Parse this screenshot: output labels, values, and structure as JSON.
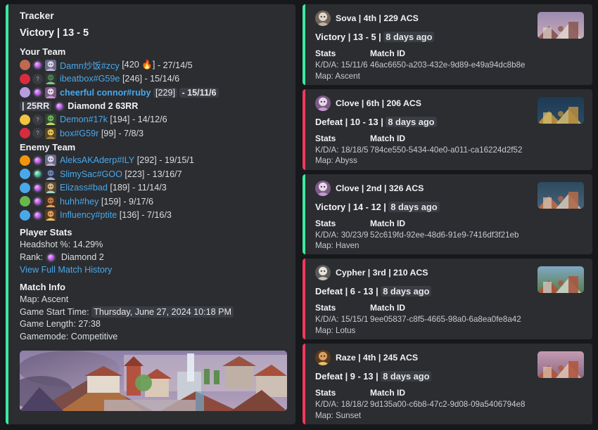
{
  "theme": {
    "app_bg": "#17181c",
    "embed_bg": "#2b2d31",
    "accent_victory": "#3ee89f",
    "accent_defeat": "#f2385a",
    "link_color": "#4aa8ea",
    "text_primary": "#f2f3f5",
    "text_secondary": "#dbdee1"
  },
  "left_panel": {
    "title": "Tracker",
    "result": "Victory | 13 - 5",
    "accent": "victory",
    "your_team": {
      "heading": "Your Team",
      "players": [
        {
          "dot_color": "#c1694f",
          "rank_icon": "diamond-rank-icon",
          "rank_tier": "purple",
          "agent_icon": "jett-agent-icon",
          "name": "Damn炒饭#zcy",
          "bold": false,
          "acs": "[420 🔥]",
          "kda": "- 27/14/5"
        },
        {
          "dot_color": "#d92b3f",
          "rank_icon": "unranked-icon",
          "rank_tier": "unknown",
          "agent_icon": "viper-agent-icon",
          "name": "ibeatbox#G59e",
          "bold": false,
          "acs": "[246]",
          "kda": "- 15/14/6"
        },
        {
          "dot_color": "#b79ce0",
          "rank_icon": "diamond-rank-icon",
          "rank_tier": "purple",
          "agent_icon": "clove-agent-icon",
          "name": "cheerful connor#ruby",
          "bold": true,
          "acs": "[229]",
          "kda": "- 15/11/6"
        },
        {
          "dot_color": "#f0c53f",
          "rank_icon": "unranked-icon",
          "rank_tier": "unknown",
          "agent_icon": "gekko-agent-icon",
          "name": "Demon#17k",
          "bold": false,
          "acs": "[194]",
          "kda": "- 14/12/6"
        },
        {
          "dot_color": "#d92b3f",
          "rank_icon": "unranked-icon",
          "rank_tier": "unknown",
          "agent_icon": "killjoy-agent-icon",
          "name": "box#G59r",
          "bold": false,
          "acs": "[99]",
          "kda": "- 7/8/3"
        }
      ],
      "rr_line": {
        "prefix": "| 25RR",
        "rank_icon": "diamond-rank-icon",
        "text": "Diamond 2 63RR"
      }
    },
    "enemy_team": {
      "heading": "Enemy Team",
      "players": [
        {
          "dot_color": "#f2940d",
          "rank_icon": "diamond-rank-icon",
          "rank_tier": "purple",
          "agent_icon": "jett-agent-icon",
          "name": "AleksAKAderp#ILY",
          "bold": false,
          "acs": "[292]",
          "kda": "- 19/15/1"
        },
        {
          "dot_color": "#4aa8ea",
          "rank_icon": "emerald-rank-icon",
          "rank_tier": "teal",
          "agent_icon": "omen-agent-icon",
          "name": "SlimySac#GOO",
          "bold": false,
          "acs": "[223]",
          "kda": "- 13/16/7"
        },
        {
          "dot_color": "#4aa8ea",
          "rank_icon": "diamond-rank-icon",
          "rank_tier": "purple",
          "agent_icon": "sage-agent-icon",
          "name": "Elizass#bad",
          "bold": false,
          "acs": "[189]",
          "kda": "- 11/14/3"
        },
        {
          "dot_color": "#67b84a",
          "rank_icon": "diamond-rank-icon",
          "rank_tier": "purple",
          "agent_icon": "skye-agent-icon",
          "name": "huhh#hey",
          "bold": false,
          "acs": "[159]",
          "kda": "- 9/17/6"
        },
        {
          "dot_color": "#4aa8ea",
          "rank_icon": "diamond-rank-icon",
          "rank_tier": "purple",
          "agent_icon": "raze-agent-icon",
          "name": "Influency#ptite",
          "bold": false,
          "acs": "[136]",
          "kda": "- 7/16/3"
        }
      ]
    },
    "player_stats": {
      "heading": "Player Stats",
      "headshot_label": "Headshot %: 14.29%",
      "rank_label": "Rank:",
      "rank_value": "Diamond 2",
      "rank_icon": "diamond-rank-icon",
      "history_link": "View Full Match History"
    },
    "match_info": {
      "heading": "Match Info",
      "map_line": "Map: Ascent",
      "start_label": "Game Start Time:",
      "start_value": "Thursday, June 27, 2024 10:18 PM",
      "length_line": "Game Length: 27:38",
      "gamemode_line": "Gamemode: Competitive"
    },
    "banner": {
      "name": "ascent-map-banner",
      "alt": "Ascent map banner"
    }
  },
  "match_history": {
    "cards": [
      {
        "agent_icon": "sova-agent-icon",
        "agent_line": "Sova | 4th | 229 ACS",
        "result": "Victory | 13 - 5 |",
        "time_ago": "8 days ago",
        "outcome": "victory",
        "stats_header": "Stats",
        "matchid_header": "Match ID",
        "kda": "K/D/A: 15/11/6",
        "match_id": "46ac6650-a203-432e-9d89-e49a94dc8b8e",
        "map_line": "Map: Ascent",
        "thumb": "ascent-map-thumb"
      },
      {
        "agent_icon": "clove-agent-icon",
        "agent_line": "Clove | 6th | 206 ACS",
        "result": "Defeat | 10 - 13 |",
        "time_ago": "8 days ago",
        "outcome": "defeat",
        "stats_header": "Stats",
        "matchid_header": "Match ID",
        "kda": "K/D/A: 18/18/5",
        "match_id": "784ce550-5434-40e0-a011-ca16224d2f52",
        "map_line": "Map: Abyss",
        "thumb": "abyss-map-thumb"
      },
      {
        "agent_icon": "clove-agent-icon",
        "agent_line": "Clove | 2nd | 326 ACS",
        "result": "Victory | 14 - 12 |",
        "time_ago": "8 days ago",
        "outcome": "victory",
        "stats_header": "Stats",
        "matchid_header": "Match ID",
        "kda": "K/D/A: 30/23/9",
        "match_id": "52c619fd-92ee-48d6-91e9-7416df3f21eb",
        "map_line": "Map: Haven",
        "thumb": "haven-map-thumb"
      },
      {
        "agent_icon": "cypher-agent-icon",
        "agent_line": "Cypher | 3rd | 210 ACS",
        "result": "Defeat | 6 - 13 |",
        "time_ago": "8 days ago",
        "outcome": "defeat",
        "stats_header": "Stats",
        "matchid_header": "Match ID",
        "kda": "K/D/A: 15/15/1",
        "match_id": "9ee05837-c8f5-4665-98a0-6a8ea0fe8a42",
        "map_line": "Map: Lotus",
        "thumb": "lotus-map-thumb"
      },
      {
        "agent_icon": "raze-agent-icon",
        "agent_line": "Raze | 4th | 245 ACS",
        "result": "Defeat | 9 - 13 |",
        "time_ago": "8 days ago",
        "outcome": "defeat",
        "stats_header": "Stats",
        "matchid_header": "Match ID",
        "kda": "K/D/A: 18/18/2",
        "match_id": "9d135a00-c6b8-47c2-9d08-09a5406794e8",
        "map_line": "Map: Sunset",
        "thumb": "sunset-map-thumb"
      }
    ]
  }
}
